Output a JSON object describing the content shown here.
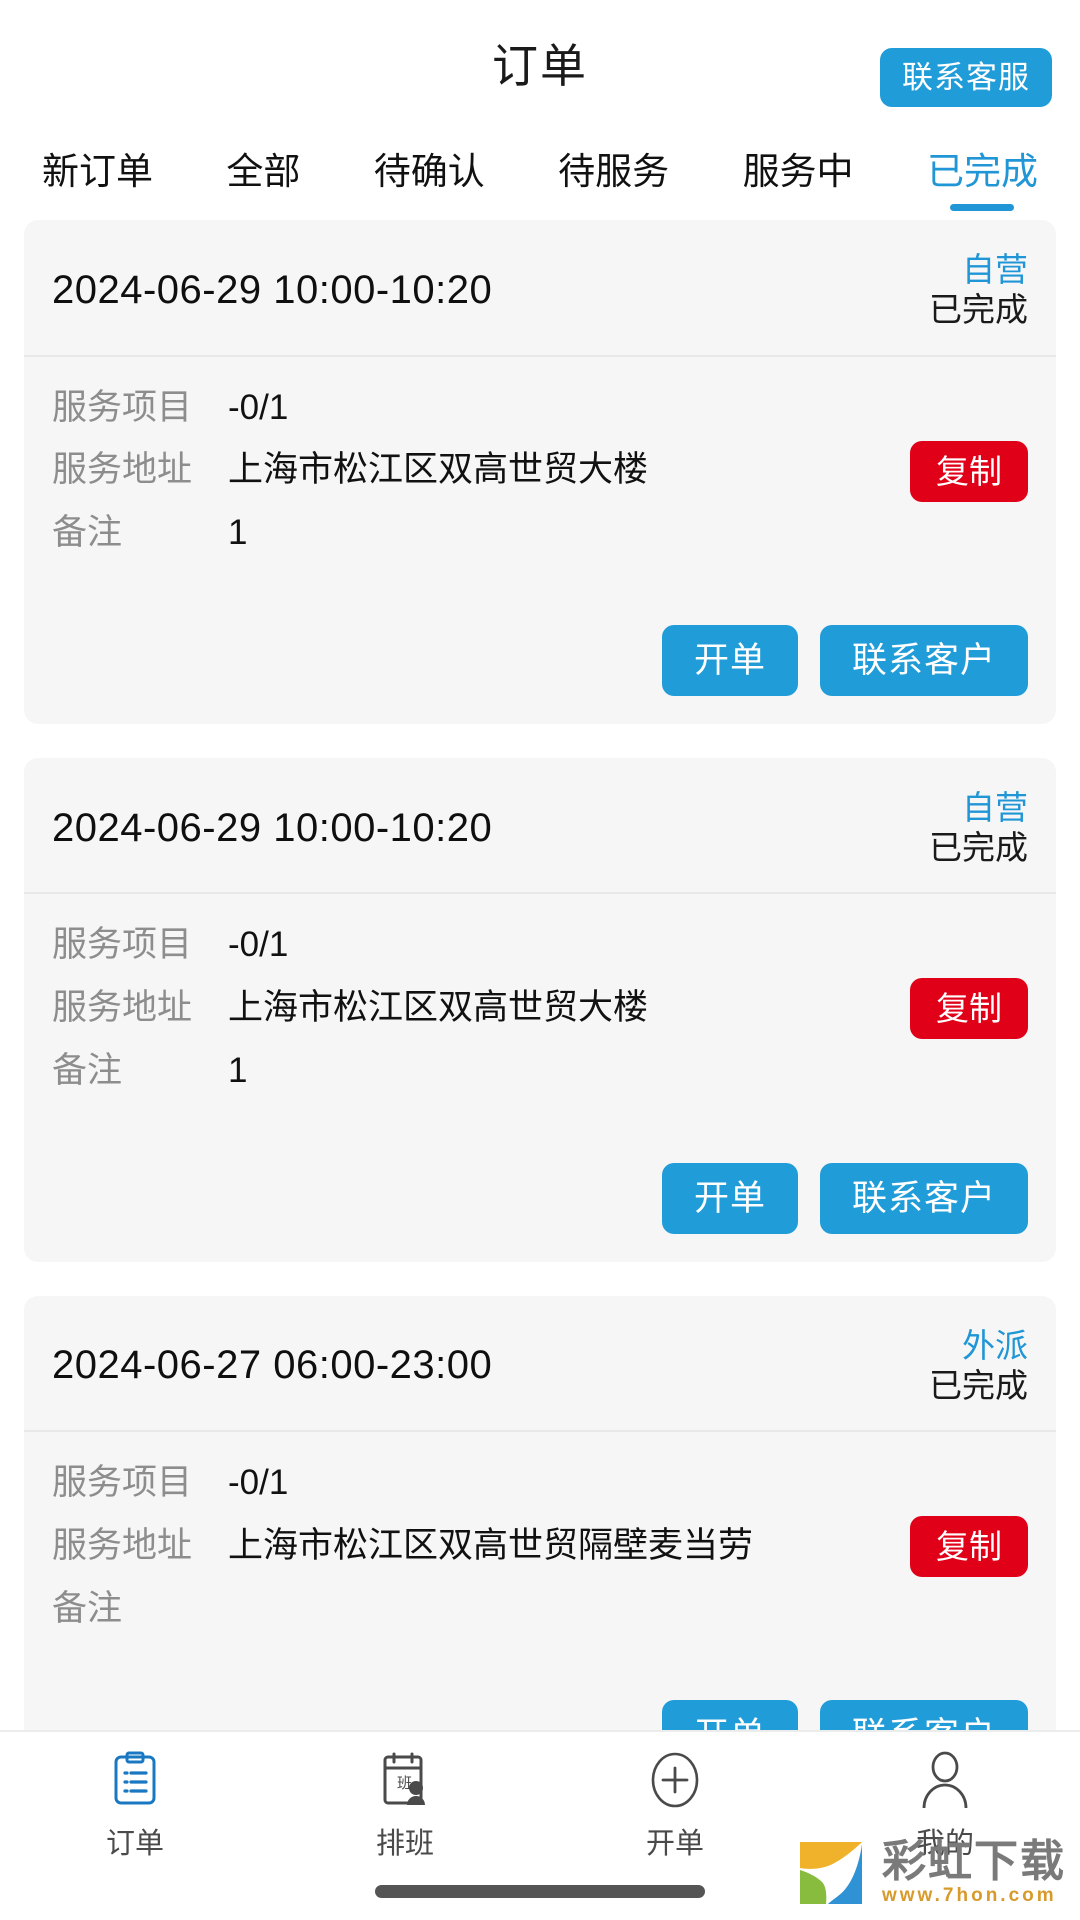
{
  "header": {
    "title": "订单",
    "contact_service_label": "联系客服"
  },
  "tabs": [
    {
      "label": "新订单",
      "active": false
    },
    {
      "label": "全部",
      "active": false
    },
    {
      "label": "待确认",
      "active": false
    },
    {
      "label": "待服务",
      "active": false
    },
    {
      "label": "服务中",
      "active": false
    },
    {
      "label": "已完成",
      "active": true
    }
  ],
  "labels": {
    "service_item": "服务项目",
    "service_address": "服务地址",
    "remark": "备注",
    "copy": "复制",
    "create_order": "开单",
    "contact_customer": "联系客户"
  },
  "orders": [
    {
      "datetime": "2024-06-29 10:00-10:20",
      "channel": "自营",
      "status": "已完成",
      "service_item": "-0/1",
      "service_address": "上海市松江区双高世贸大楼",
      "remark": "1"
    },
    {
      "datetime": "2024-06-29 10:00-10:20",
      "channel": "自营",
      "status": "已完成",
      "service_item": "-0/1",
      "service_address": "上海市松江区双高世贸大楼",
      "remark": "1"
    },
    {
      "datetime": "2024-06-27 06:00-23:00",
      "channel": "外派",
      "status": "已完成",
      "service_item": "-0/1",
      "service_address": "上海市松江区双高世贸隔壁麦当劳",
      "remark": ""
    }
  ],
  "bottom_nav": [
    {
      "label": "订单",
      "icon": "clipboard-list-icon",
      "active": true
    },
    {
      "label": "排班",
      "icon": "schedule-person-icon",
      "active": false
    },
    {
      "label": "开单",
      "icon": "plus-circle-icon",
      "active": false
    },
    {
      "label": "我的",
      "icon": "person-icon",
      "active": false
    }
  ],
  "watermark": {
    "title": "彩虹下载",
    "url": "www.7hon.com"
  },
  "colors": {
    "accent_blue": "#209cd8",
    "tab_active": "#2196d6",
    "copy_red": "#e00017",
    "card_bg": "#f6f6f6",
    "label_gray": "#8d8d8d"
  }
}
